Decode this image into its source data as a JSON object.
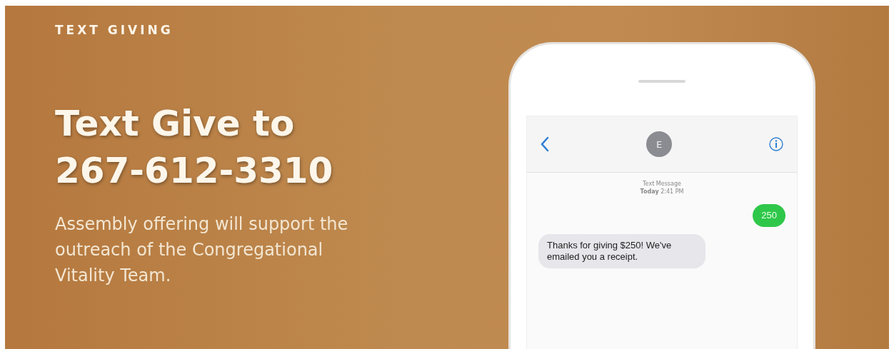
{
  "eyebrow": "TEXT GIVING",
  "headline": [
    "Text Give to",
    "267-612-3310"
  ],
  "description": "Assembly offering will support the outreach of the Congregational Vitality Team.",
  "phone": {
    "contact_initial": "E",
    "thread_label": "Text Message",
    "timestamp_day": "Today",
    "timestamp_time": "2:41 PM",
    "messages": [
      {
        "kind": "sent",
        "text": "250"
      },
      {
        "kind": "received",
        "text": "Thanks for giving $250! We've emailed you a receipt."
      }
    ]
  }
}
